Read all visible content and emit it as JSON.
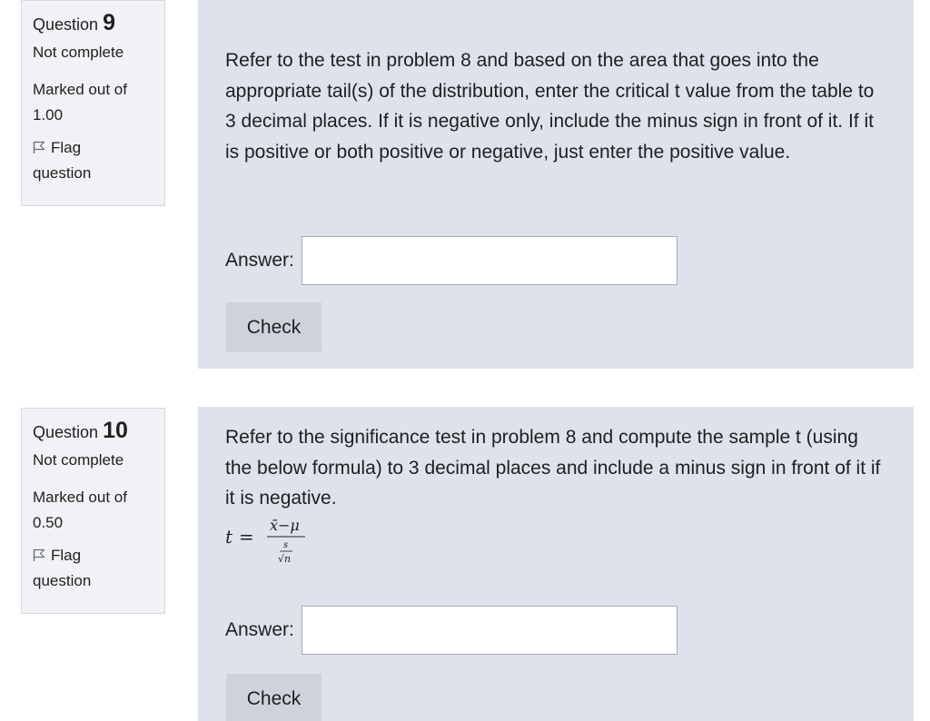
{
  "questions": [
    {
      "label": "Question",
      "number": "9",
      "state": "Not complete",
      "marked_label": "Marked out of",
      "max_mark": "1.00",
      "flag_line1": "Flag",
      "flag_line2": "question",
      "text": "Refer to the test in problem 8 and based on the area that goes into the appropriate tail(s) of the distribution, enter the critical t value from the table to 3 decimal places. If it is negative only, include the minus sign in front of it. If it is positive or both positive or negative, just enter the positive value.",
      "answer_label": "Answer:",
      "answer_value": "",
      "check_label": "Check"
    },
    {
      "label": "Question",
      "number": "10",
      "state": "Not complete",
      "marked_label": "Marked out of",
      "max_mark": "0.50",
      "flag_line1": "Flag",
      "flag_line2": "question",
      "text": "Refer to the significance test in problem 8 and compute the sample t (using the below formula) to 3 decimal places and include a minus sign in front of it if it is negative.",
      "formula": {
        "lhs": "t",
        "equals": "=",
        "numerator": "x̄−μ",
        "inner_numerator": "s",
        "inner_denominator": "√n"
      },
      "answer_label": "Answer:",
      "answer_value": "",
      "check_label": "Check"
    }
  ],
  "icons": {
    "flag": "flag-icon"
  }
}
